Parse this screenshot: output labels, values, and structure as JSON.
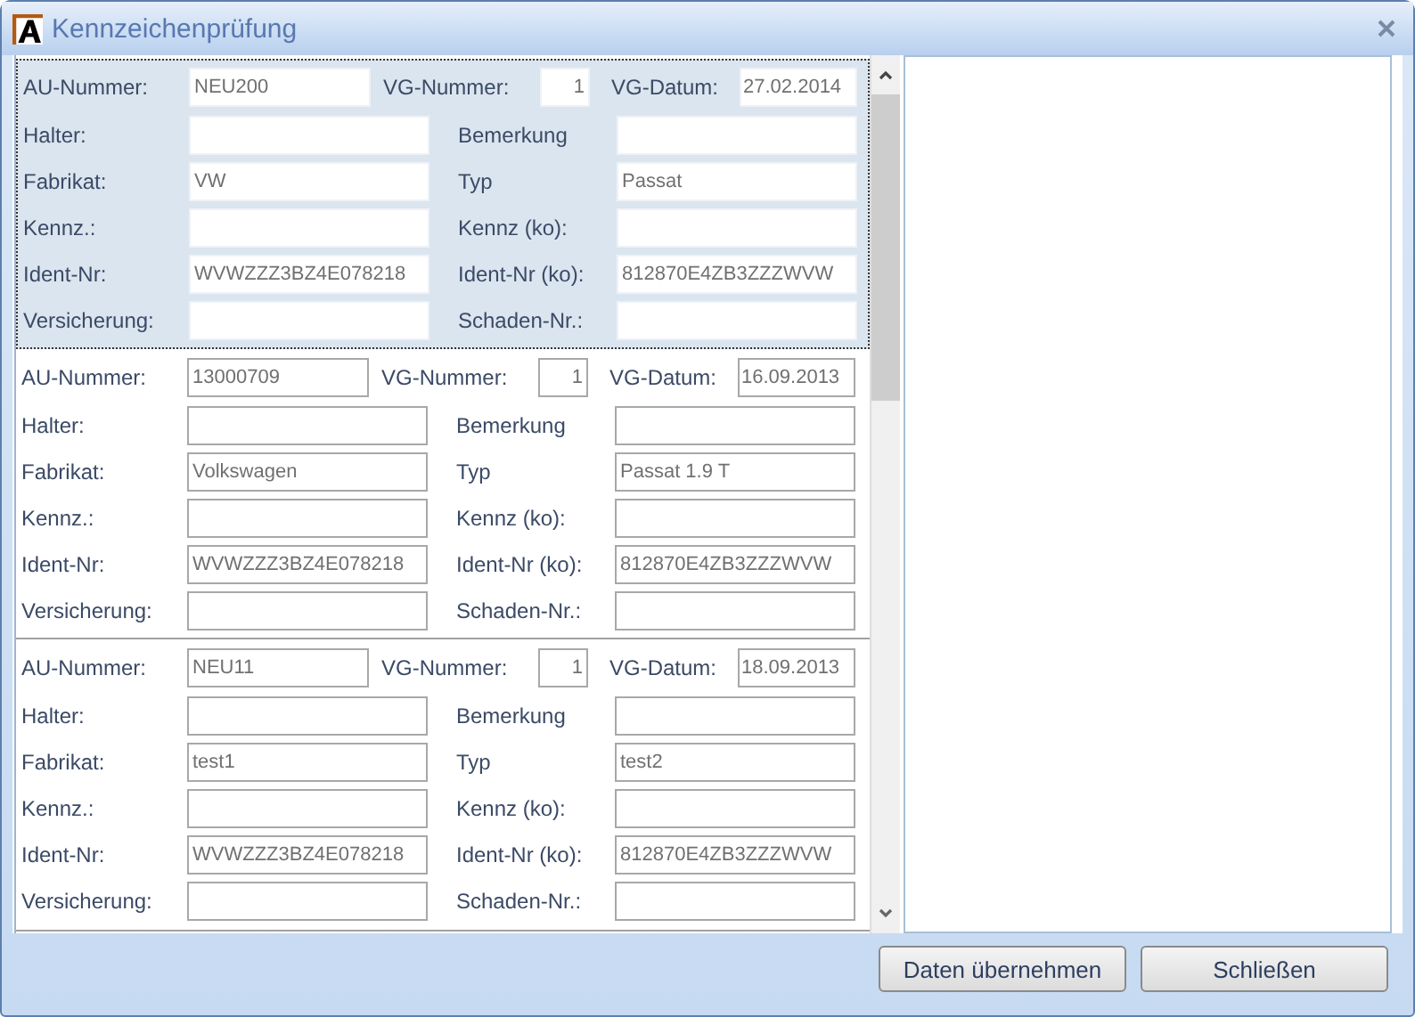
{
  "window": {
    "title": "Kennzeichenprüfung"
  },
  "records": [
    {
      "selected": true,
      "fields": [
        {
          "label": "AU-Nummer:",
          "value": "NEU200"
        },
        {
          "label": "VG-Nummer:",
          "value": "1"
        },
        {
          "label": "VG-Datum:",
          "value": "27.02.2014"
        },
        {
          "label": "Halter:"
        },
        {
          "label": "Bemerkung"
        },
        {
          "label": "Fabrikat:",
          "value": "VW"
        },
        {
          "label": "Typ",
          "value": "Passat"
        },
        {
          "label": "Kennz.:"
        },
        {
          "label": "Kennz (ko):"
        },
        {
          "label": "Ident-Nr:",
          "value": "WVWZZZ3BZ4E078218"
        },
        {
          "label": "Ident-Nr (ko):",
          "value": "812870E4ZB3ZZZWVW"
        },
        {
          "label": "Versicherung:"
        },
        {
          "label": "Schaden-Nr.:"
        }
      ]
    },
    {
      "selected": false,
      "fields": [
        {
          "label": "AU-Nummer:",
          "value": "13000709"
        },
        {
          "label": "VG-Nummer:",
          "value": "1"
        },
        {
          "label": "VG-Datum:",
          "value": "16.09.2013"
        },
        {
          "label": "Halter:"
        },
        {
          "label": "Bemerkung"
        },
        {
          "label": "Fabrikat:",
          "value": "Volkswagen"
        },
        {
          "label": "Typ",
          "value": "Passat 1.9 T"
        },
        {
          "label": "Kennz.:"
        },
        {
          "label": "Kennz (ko):"
        },
        {
          "label": "Ident-Nr:",
          "value": "WVWZZZ3BZ4E078218"
        },
        {
          "label": "Ident-Nr (ko):",
          "value": "812870E4ZB3ZZZWVW"
        },
        {
          "label": "Versicherung:"
        },
        {
          "label": "Schaden-Nr.:"
        }
      ]
    },
    {
      "selected": false,
      "fields": [
        {
          "label": "AU-Nummer:",
          "value": "NEU11"
        },
        {
          "label": "VG-Nummer:",
          "value": "1"
        },
        {
          "label": "VG-Datum:",
          "value": "18.09.2013"
        },
        {
          "label": "Halter:"
        },
        {
          "label": "Bemerkung"
        },
        {
          "label": "Fabrikat:",
          "value": "test1"
        },
        {
          "label": "Typ",
          "value": "test2"
        },
        {
          "label": "Kennz.:"
        },
        {
          "label": "Kennz (ko):"
        },
        {
          "label": "Ident-Nr:",
          "value": "WVWZZZ3BZ4E078218"
        },
        {
          "label": "Ident-Nr (ko):",
          "value": "812870E4ZB3ZZZWVW"
        },
        {
          "label": "Versicherung:"
        },
        {
          "label": "Schaden-Nr.:"
        }
      ]
    }
  ],
  "buttons": [
    {
      "label": "Daten übernehmen"
    },
    {
      "label": "Schließen"
    }
  ]
}
